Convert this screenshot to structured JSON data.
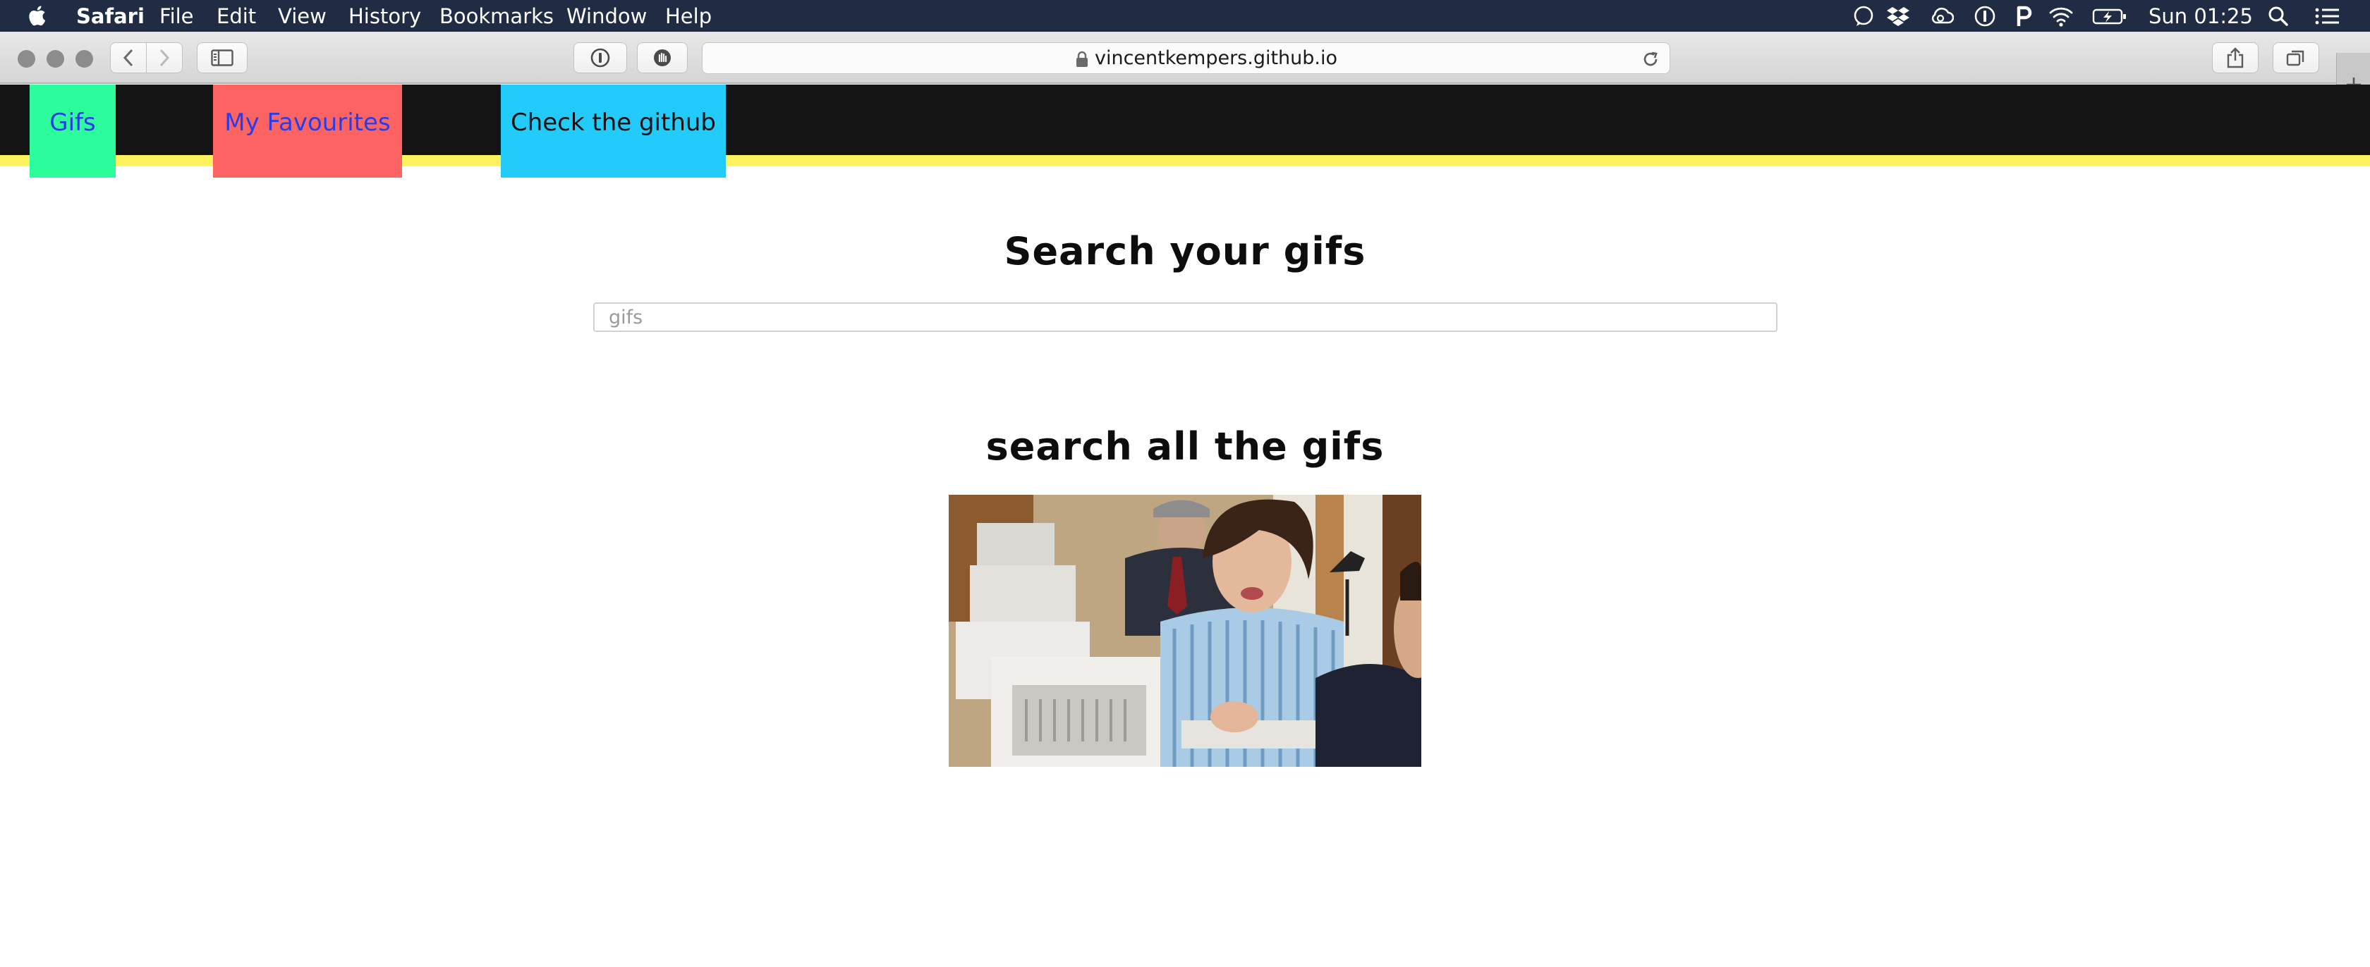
{
  "menubar": {
    "app_name": "Safari",
    "menus": [
      "File",
      "Edit",
      "View",
      "History",
      "Bookmarks",
      "Window",
      "Help"
    ],
    "status_icons": [
      "messages-icon",
      "dropbox-icon",
      "creative-cloud-icon",
      "1password-icon",
      "pocket-icon",
      "wifi-icon",
      "battery-charging-icon"
    ],
    "clock": "Sun 01:25"
  },
  "browser": {
    "url": "vincentkempers.github.io"
  },
  "site": {
    "nav": {
      "gifs": "Gifs",
      "favourites": "My Favourites",
      "github": "Check the github"
    },
    "colors": {
      "header_bg": "#141414",
      "accent_line": "#fcf35c",
      "gifs_tab": "#2cfc9c",
      "favourites_tab": "#fc6464",
      "github_tab": "#23cbfb",
      "link_text": "#2a3ce8"
    },
    "title": "Search your gifs",
    "search": {
      "placeholder": "gifs",
      "value": ""
    },
    "results_title": "search all the gifs"
  }
}
